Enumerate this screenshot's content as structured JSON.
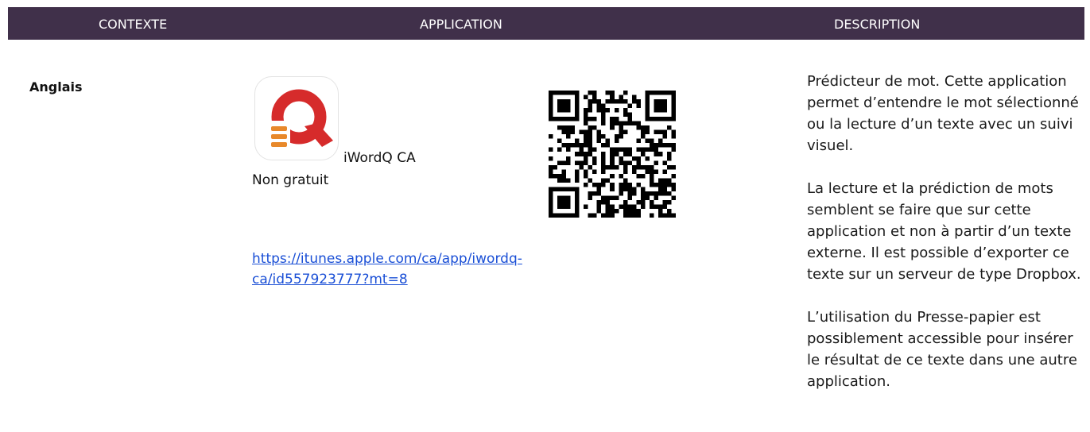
{
  "header": {
    "col1": "CONTEXTE",
    "col2": "APPLICATION",
    "col3": "DESCRIPTION"
  },
  "row": {
    "context": "Anglais",
    "app": {
      "name": "iWordQ CA",
      "price": "Non gratuit",
      "link_line1": "https://itunes.apple.com/ca/app/iwordq-",
      "link_line2": "ca/id557923777?mt=8",
      "icon": "iwordq-app-icon",
      "qr": "qr-code"
    },
    "description": {
      "p1": "Prédicteur de mot. Cette application permet d’entendre le mot sélectionné ou la lecture d’un texte avec un suivi visuel.",
      "p2": "La lecture et la prédiction de mots semblent se faire que sur cette application et non à partir d’un texte externe. Il est possible d’exporter ce texte sur un serveur de type Dropbox.",
      "p3": "L’utilisation du Presse-papier est possiblement accessible pour insérer le résultat de ce texte dans une autre application."
    }
  },
  "colors": {
    "header_bg": "#40304a",
    "header_text": "#ffffff",
    "link": "#1a4fd6",
    "icon_red": "#d62b2b",
    "icon_orange": "#e8892b"
  }
}
